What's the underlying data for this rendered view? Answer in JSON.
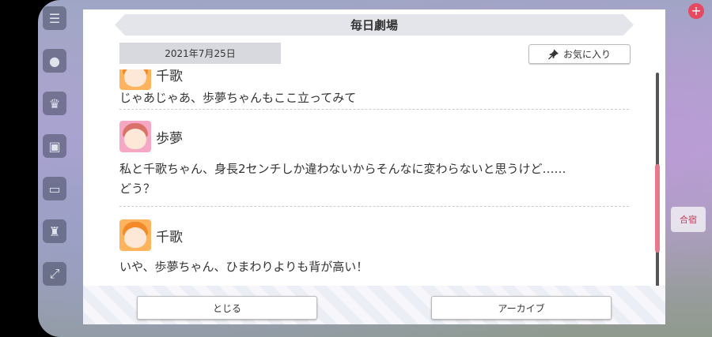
{
  "header": {
    "title": "毎日劇場",
    "date": "2021年7月25日",
    "favorite_label": "お気に入り"
  },
  "messages": [
    {
      "speaker": "千歌",
      "avatar": "chika-avatar",
      "text": "じゃあじゃあ、歩夢ちゃんもここ立ってみて"
    },
    {
      "speaker": "歩夢",
      "avatar": "ayumu-avatar",
      "text": "私と千歌ちゃん、身長2センチしか違わないからそんなに変わらないと思うけど……",
      "text2": "どう？"
    },
    {
      "speaker": "千歌",
      "avatar": "chika-avatar",
      "text": "いや、歩夢ちゃん、ひまわりよりも背が高い！"
    }
  ],
  "buttons": {
    "close": "とじる",
    "archive": "アーカイブ"
  },
  "background": {
    "right_tag": "合宿"
  },
  "colors": {
    "accent": "#e8798c",
    "title_bar": "#e4e5ea",
    "date_box": "#d8d9de"
  }
}
